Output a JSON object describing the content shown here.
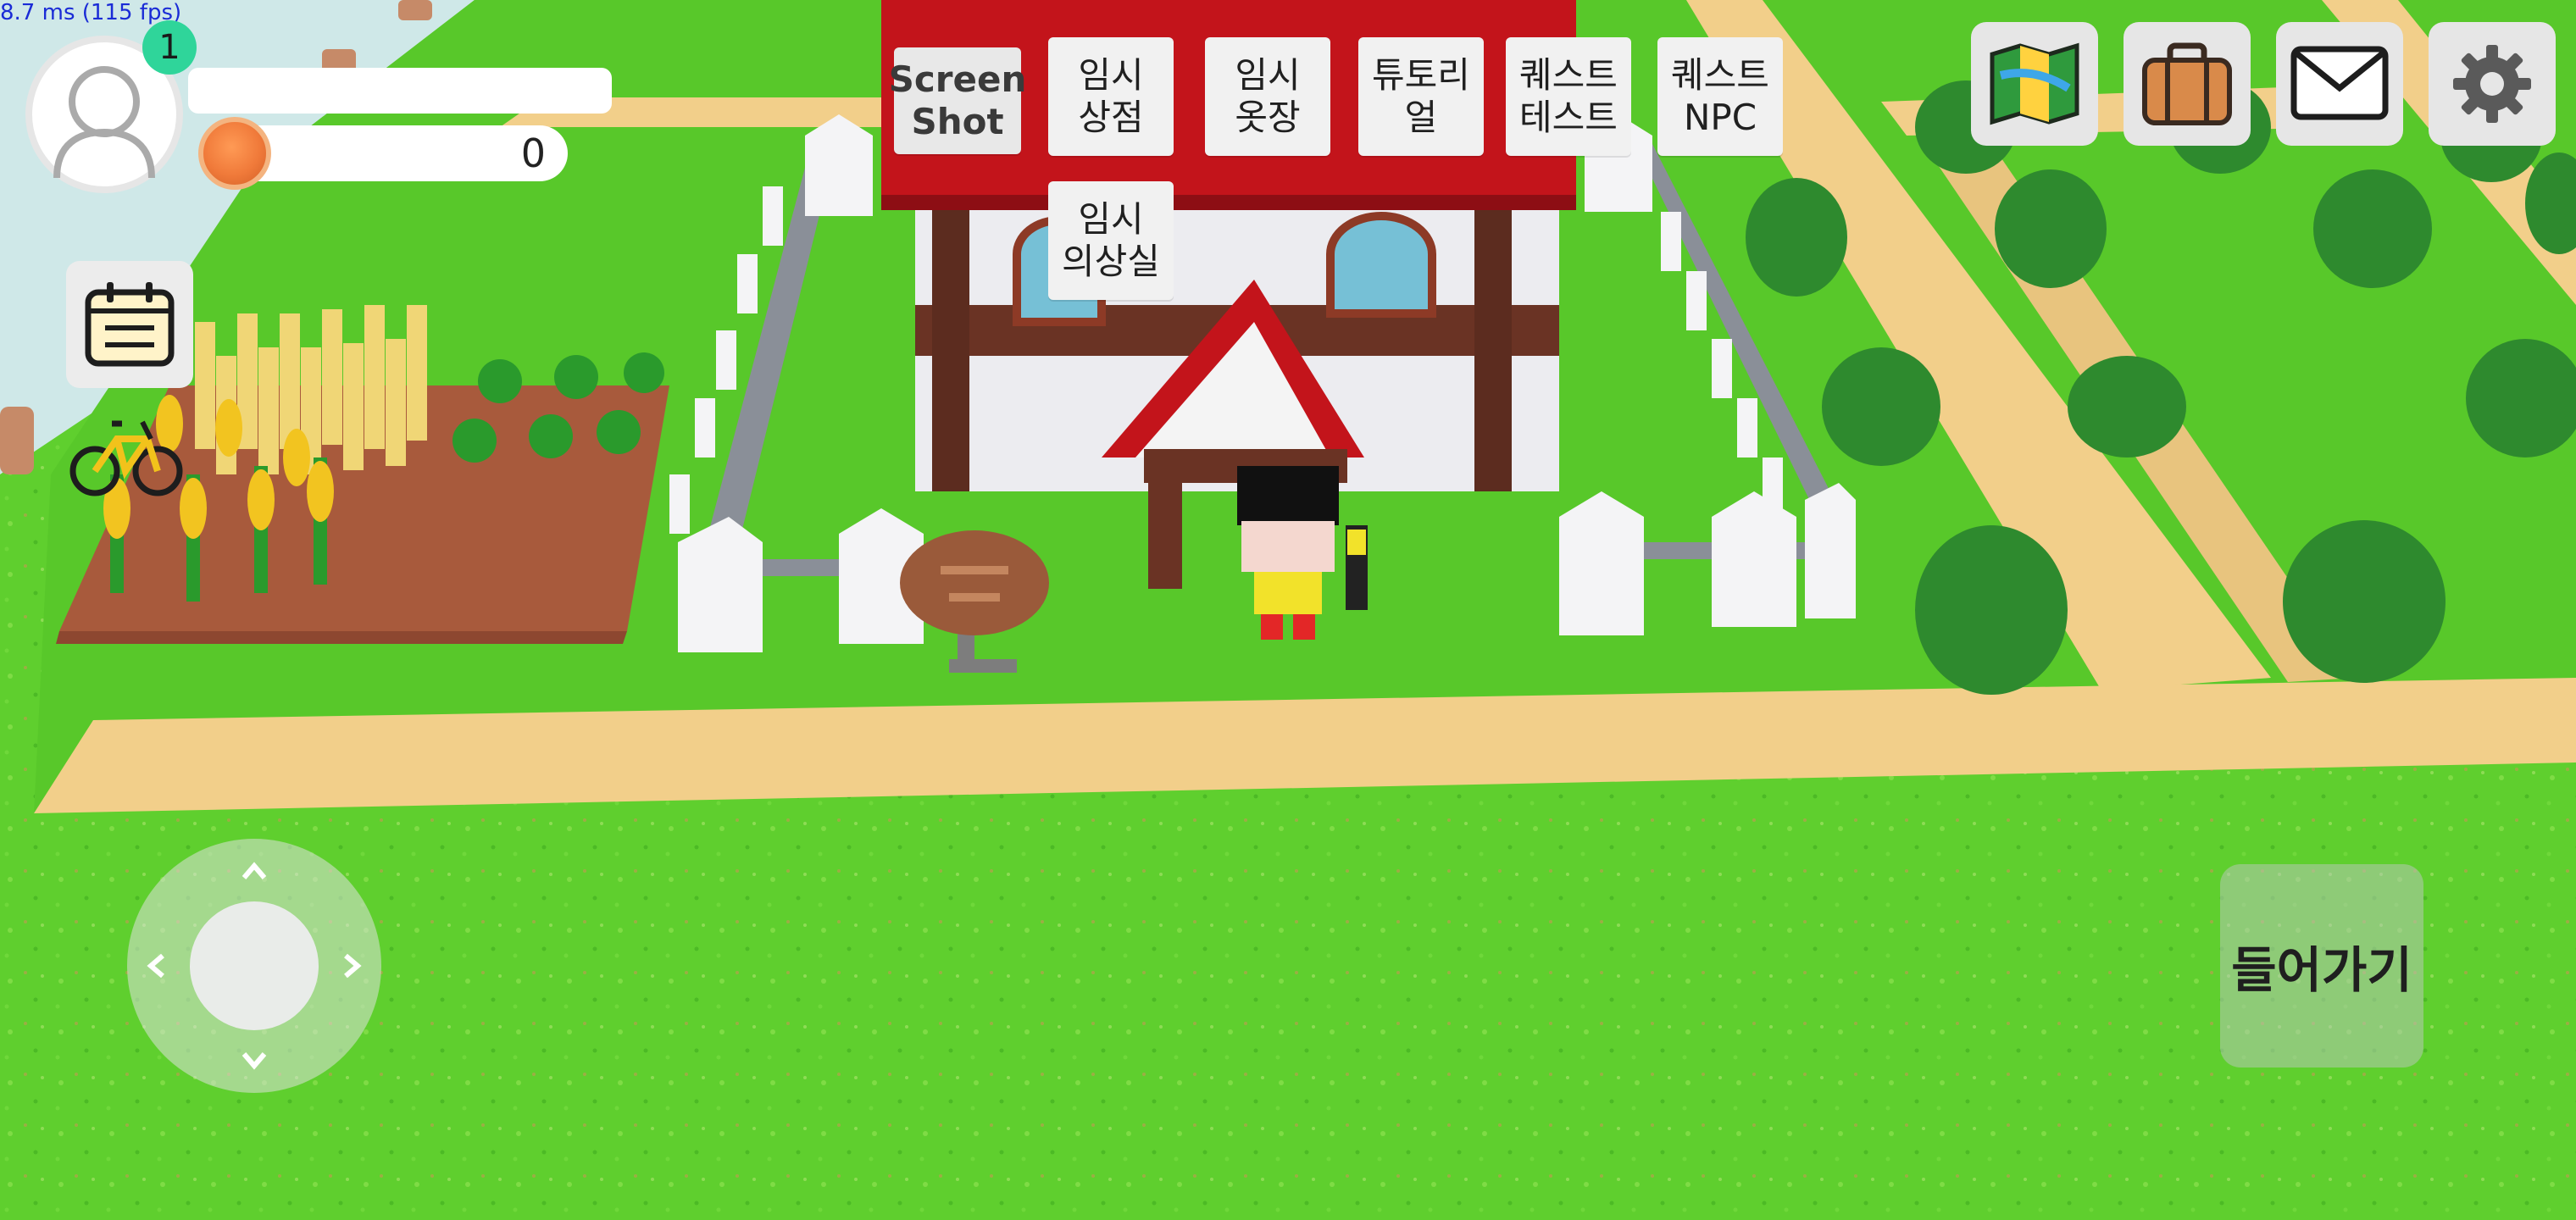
{
  "hud": {
    "fps_readout": "8.7 ms (115 fps)",
    "level": "1",
    "coins": "0"
  },
  "debug_buttons": [
    {
      "id": "screenshot",
      "label": "Screen\nShot"
    },
    {
      "id": "temp-shop",
      "label": "임시\n상점"
    },
    {
      "id": "temp-wardrobe",
      "label": "임시\n옷장"
    },
    {
      "id": "tutorial",
      "label": "튜토리\n얼"
    },
    {
      "id": "quest-test",
      "label": "퀘스트\n테스트"
    },
    {
      "id": "quest-npc",
      "label": "퀘스트\nNPC"
    },
    {
      "id": "temp-dressing-room",
      "label": "임시\n의상실"
    }
  ],
  "top_right_icons": [
    "map-icon",
    "bag-icon",
    "mail-icon",
    "gear-icon"
  ],
  "left_icons": [
    "calendar-icon",
    "bicycle-icon"
  ],
  "action": {
    "enter_label": "들어가기"
  },
  "colors": {
    "grass": "#5fcf2e",
    "path": "#f2cf8a",
    "roof": "#c3141b",
    "fence": "#f4f4f6",
    "level_badge": "#2fd59a",
    "coin": "#f07a3a"
  }
}
